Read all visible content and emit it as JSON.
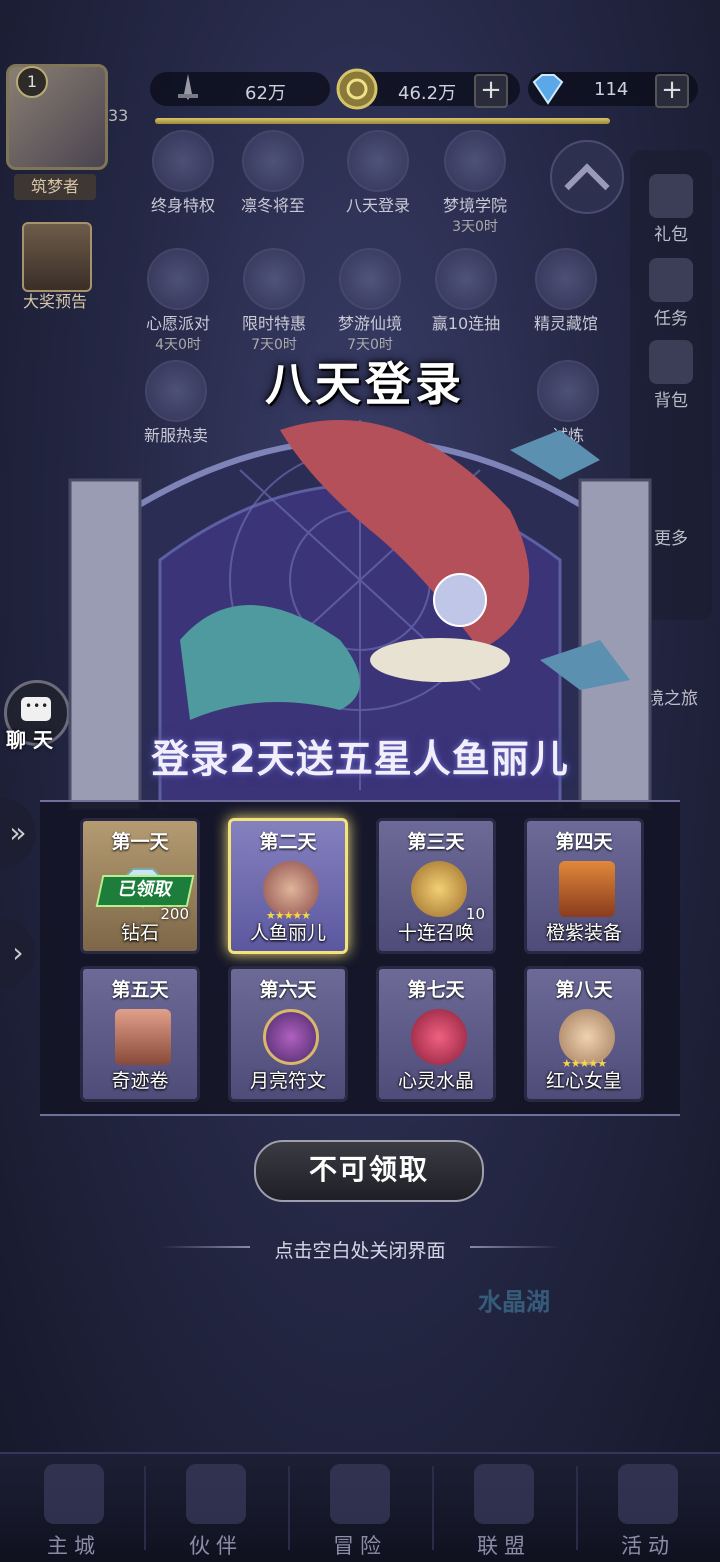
{
  "topbar": {
    "level": "1",
    "uid": "33",
    "power": "62万",
    "gold": "46.2万",
    "gems": "114",
    "plus": "+"
  },
  "player": {
    "title": "筑梦者",
    "preview_label": "大奖预告"
  },
  "features": [
    {
      "label": "终身特权",
      "sub": ""
    },
    {
      "label": "凛冬将至",
      "sub": ""
    },
    {
      "label": "八天登录",
      "sub": ""
    },
    {
      "label": "梦境学院",
      "sub": "3天0时"
    },
    {
      "label": "心愿派对",
      "sub": "4天0时"
    },
    {
      "label": "限时特惠",
      "sub": "7天0时"
    },
    {
      "label": "梦游仙境",
      "sub": "7天0时"
    },
    {
      "label": "赢10连抽",
      "sub": ""
    },
    {
      "label": "精灵藏馆",
      "sub": ""
    },
    {
      "label": "新服热卖",
      "sub": ""
    },
    {
      "label": "试炼",
      "sub": ""
    }
  ],
  "right_menu": [
    "礼包",
    "任务",
    "背包",
    "更多",
    "梦境之旅"
  ],
  "chat": {
    "label": "聊 天"
  },
  "event": {
    "title": "八天登录",
    "banner": "登录2天送五星人鱼丽儿",
    "days": [
      {
        "day": "第一天",
        "item": "钻石",
        "qty": "200",
        "status": "已领取"
      },
      {
        "day": "第二天",
        "item": "人鱼丽儿",
        "qty": "",
        "status": ""
      },
      {
        "day": "第三天",
        "item": "十连召唤",
        "qty": "10",
        "status": ""
      },
      {
        "day": "第四天",
        "item": "橙紫装备",
        "qty": "",
        "status": ""
      },
      {
        "day": "第五天",
        "item": "奇迹卷",
        "qty": "",
        "status": ""
      },
      {
        "day": "第六天",
        "item": "月亮符文",
        "qty": "",
        "status": ""
      },
      {
        "day": "第七天",
        "item": "心灵水晶",
        "qty": "",
        "status": ""
      },
      {
        "day": "第八天",
        "item": "红心女皇",
        "qty": "",
        "status": ""
      }
    ],
    "button": "不可领取",
    "hint": "点击空白处关闭界面"
  },
  "map_label": "水晶湖",
  "nav": [
    "主城",
    "伙伴",
    "冒险",
    "联盟",
    "活动"
  ]
}
